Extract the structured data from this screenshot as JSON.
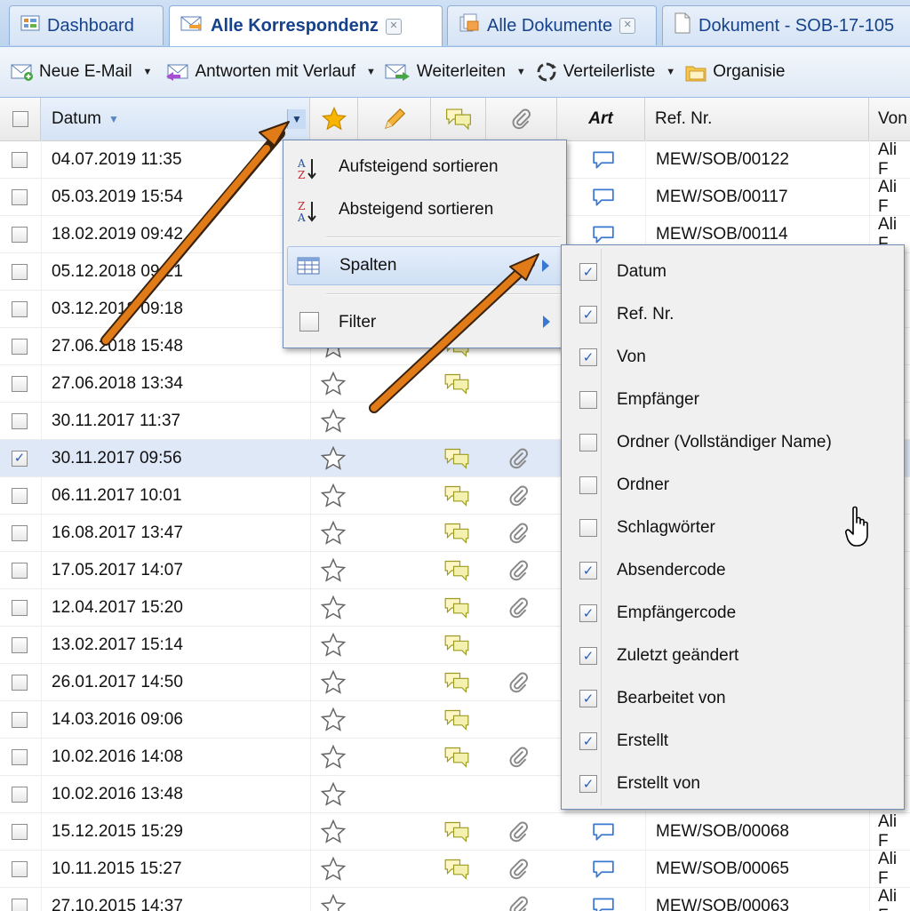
{
  "tabs": [
    {
      "label": "Dashboard",
      "icon": "dashboard-icon",
      "closable": false,
      "active": false
    },
    {
      "label": "Alle Korrespondenz",
      "icon": "mail-icon",
      "closable": true,
      "active": true
    },
    {
      "label": "Alle Dokumente",
      "icon": "documents-icon",
      "closable": true,
      "active": false
    },
    {
      "label": "Dokument - SOB-17-105",
      "icon": "document-icon",
      "closable": false,
      "active": false
    }
  ],
  "toolbar": [
    {
      "label": "Neue E-Mail",
      "icon": "new-email-icon"
    },
    {
      "label": "Antworten mit Verlauf",
      "icon": "reply-icon"
    },
    {
      "label": "Weiterleiten",
      "icon": "forward-icon"
    },
    {
      "label": "Verteilerliste",
      "icon": "distribution-list-icon"
    },
    {
      "label": "Organisie",
      "icon": "organize-icon"
    }
  ],
  "columns": {
    "datum": "Datum",
    "art": "Art",
    "ref": "Ref. Nr.",
    "von": "Von"
  },
  "rows": [
    {
      "date": "04.07.2019 11:35",
      "star": "filled",
      "bubble": false,
      "clip": false,
      "art": true,
      "ref": "MEW/SOB/00122",
      "from": "Ali F",
      "checked": false
    },
    {
      "date": "05.03.2019 15:54",
      "star": "none",
      "bubble": false,
      "clip": false,
      "art": true,
      "ref": "MEW/SOB/00117",
      "from": "Ali F",
      "checked": false
    },
    {
      "date": "18.02.2019 09:42",
      "star": "none",
      "bubble": false,
      "clip": false,
      "art": true,
      "ref": "MEW/SOB/00114",
      "from": "Ali F",
      "checked": false
    },
    {
      "date": "05.12.2018 09:21",
      "star": "none",
      "bubble": false,
      "clip": false,
      "art": false,
      "ref": "",
      "from": "F",
      "checked": false
    },
    {
      "date": "03.12.2018 09:18",
      "star": "none",
      "bubble": false,
      "clip": false,
      "art": false,
      "ref": "",
      "from": "F",
      "checked": false
    },
    {
      "date": "27.06.2018 15:48",
      "star": "outline",
      "bubble": true,
      "clip": false,
      "art": false,
      "ref": "",
      "from": "F",
      "checked": false
    },
    {
      "date": "27.06.2018 13:34",
      "star": "outline",
      "bubble": true,
      "clip": false,
      "art": false,
      "ref": "",
      "from": "F",
      "checked": false
    },
    {
      "date": "30.11.2017 11:37",
      "star": "outline",
      "bubble": false,
      "clip": false,
      "art": false,
      "ref": "",
      "from": "F",
      "checked": false
    },
    {
      "date": "30.11.2017 09:56",
      "star": "outline",
      "bubble": true,
      "clip": true,
      "art": false,
      "ref": "",
      "from": "F",
      "checked": true
    },
    {
      "date": "06.11.2017 10:01",
      "star": "outline",
      "bubble": true,
      "clip": true,
      "art": false,
      "ref": "",
      "from": "F",
      "checked": false
    },
    {
      "date": "16.08.2017 13:47",
      "star": "outline",
      "bubble": true,
      "clip": true,
      "art": false,
      "ref": "",
      "from": "F",
      "checked": false
    },
    {
      "date": "17.05.2017 14:07",
      "star": "outline",
      "bubble": true,
      "clip": true,
      "art": false,
      "ref": "",
      "from": "F",
      "checked": false
    },
    {
      "date": "12.04.2017 15:20",
      "star": "outline",
      "bubble": true,
      "clip": true,
      "art": false,
      "ref": "",
      "from": "F",
      "checked": false
    },
    {
      "date": "13.02.2017 15:14",
      "star": "outline",
      "bubble": true,
      "clip": false,
      "art": false,
      "ref": "",
      "from": "n",
      "checked": false
    },
    {
      "date": "26.01.2017 14:50",
      "star": "outline",
      "bubble": true,
      "clip": true,
      "art": false,
      "ref": "",
      "from": "F",
      "checked": false
    },
    {
      "date": "14.03.2016 09:06",
      "star": "outline",
      "bubble": true,
      "clip": false,
      "art": false,
      "ref": "",
      "from": "c",
      "checked": false
    },
    {
      "date": "10.02.2016 14:08",
      "star": "outline",
      "bubble": true,
      "clip": true,
      "art": false,
      "ref": "",
      "from": "b",
      "checked": false
    },
    {
      "date": "10.02.2016 13:48",
      "star": "outline",
      "bubble": false,
      "clip": false,
      "art": false,
      "ref": "",
      "from": "n",
      "checked": false
    },
    {
      "date": "15.12.2015 15:29",
      "star": "outline",
      "bubble": true,
      "clip": true,
      "art": true,
      "ref": "MEW/SOB/00068",
      "from": "Ali F",
      "checked": false
    },
    {
      "date": "10.11.2015 15:27",
      "star": "outline",
      "bubble": true,
      "clip": true,
      "art": true,
      "ref": "MEW/SOB/00065",
      "from": "Ali F",
      "checked": false
    },
    {
      "date": "27.10.2015 14:37",
      "star": "outline",
      "bubble": false,
      "clip": true,
      "art": true,
      "ref": "MEW/SOB/00063",
      "from": "Ali F",
      "checked": false
    }
  ],
  "column_menu": {
    "sort_asc": "Aufsteigend sortieren",
    "sort_desc": "Absteigend sortieren",
    "columns": "Spalten",
    "filter": "Filter"
  },
  "columns_submenu": [
    {
      "label": "Datum",
      "checked": true
    },
    {
      "label": "Ref. Nr.",
      "checked": true
    },
    {
      "label": "Von",
      "checked": true
    },
    {
      "label": "Empfänger",
      "checked": false
    },
    {
      "label": "Ordner (Vollständiger Name)",
      "checked": false
    },
    {
      "label": "Ordner",
      "checked": false
    },
    {
      "label": "Schlagwörter",
      "checked": false
    },
    {
      "label": "Absendercode",
      "checked": true
    },
    {
      "label": "Empfängercode",
      "checked": true
    },
    {
      "label": "Zuletzt geändert",
      "checked": true
    },
    {
      "label": "Bearbeitet von",
      "checked": true
    },
    {
      "label": "Erstellt",
      "checked": true
    },
    {
      "label": "Erstellt von",
      "checked": true
    }
  ],
  "colors": {
    "accent": "#15428b",
    "annotation_arrow": "#e07b17",
    "selected_row": "#dfe8f6"
  }
}
